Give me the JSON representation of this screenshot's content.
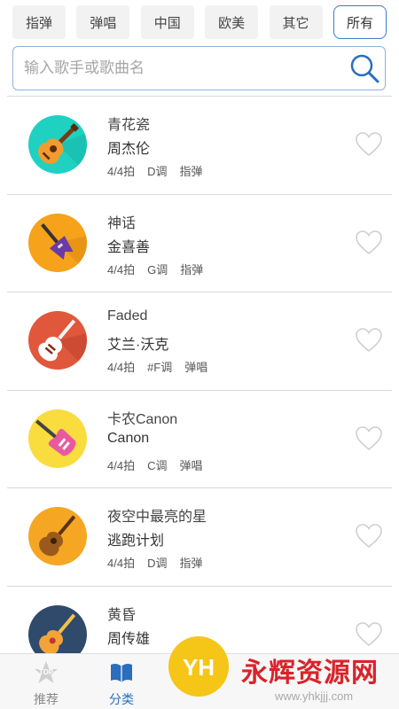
{
  "filters": [
    {
      "label": "指弹",
      "active": false
    },
    {
      "label": "弹唱",
      "active": false
    },
    {
      "label": "中国",
      "active": false
    },
    {
      "label": "欧美",
      "active": false
    },
    {
      "label": "其它",
      "active": false
    },
    {
      "label": "所有",
      "active": true
    }
  ],
  "search": {
    "placeholder": "输入歌手或歌曲名"
  },
  "songs": [
    {
      "title": "青花瓷",
      "artist": "周杰伦",
      "beat": "4/4拍",
      "key": "D调",
      "style": "指弹",
      "icon": "acoustic-guitar-icon",
      "color": "#1fd1c1"
    },
    {
      "title": "神话",
      "artist": "金喜善",
      "beat": "4/4拍",
      "key": "G调",
      "style": "指弹",
      "icon": "electric-guitar-icon",
      "color": "#f6a21a"
    },
    {
      "title": "Faded",
      "artist": "艾兰·沃克",
      "beat": "4/4拍",
      "key": "#F调",
      "style": "弹唱",
      "icon": "electric-guitar-icon",
      "color": "#e0573b"
    },
    {
      "title": "卡农Canon",
      "artist": "Canon",
      "beat": "4/4拍",
      "key": "C调",
      "style": "弹唱",
      "icon": "electric-guitar-icon",
      "color": "#f9dc3e"
    },
    {
      "title": "夜空中最亮的星",
      "artist": "逃跑计划",
      "beat": "4/4拍",
      "key": "D调",
      "style": "指弹",
      "icon": "acoustic-guitar-icon",
      "color": "#f5a623"
    },
    {
      "title": "黄昏",
      "artist": "周传雄",
      "beat": "",
      "key": "",
      "style": "",
      "icon": "ukulele-icon",
      "color": "#2f4a6b"
    }
  ],
  "nav": {
    "recommend": {
      "label": "推荐",
      "badge": "TOP",
      "icon": "star-top-icon"
    },
    "category": {
      "label": "分类",
      "icon": "book-icon"
    }
  },
  "watermark": {
    "text": "永辉资源网",
    "url": "www.yhkjjj.com",
    "logo_text": "YH"
  },
  "colors": {
    "accent": "#3b7bc8",
    "active_nav": "#2a6ebd",
    "heart": "#cfcfcf",
    "divider": "#d9d9d9"
  }
}
